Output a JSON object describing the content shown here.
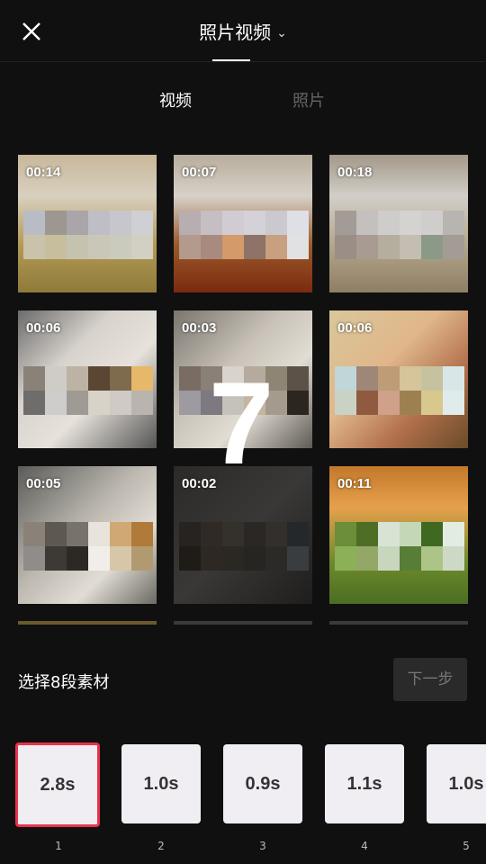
{
  "header": {
    "title": "照片视频",
    "chevron_icon": "chevron-down-icon",
    "close_icon": "close-icon"
  },
  "tabs": [
    {
      "label": "视频",
      "active": true
    },
    {
      "label": "照片",
      "active": false
    }
  ],
  "grid": {
    "tiles": [
      {
        "duration": "00:14"
      },
      {
        "duration": "00:07"
      },
      {
        "duration": "00:18"
      },
      {
        "duration": "00:06"
      },
      {
        "duration": "00:03"
      },
      {
        "duration": "00:06"
      },
      {
        "duration": "00:05"
      },
      {
        "duration": "00:02"
      },
      {
        "duration": "00:11"
      }
    ]
  },
  "overlay_number": "7",
  "footer": {
    "select_label": "选择8段素材",
    "next_button": "下一步"
  },
  "slots": [
    {
      "duration": "2.8s",
      "index": "1",
      "selected": true
    },
    {
      "duration": "1.0s",
      "index": "2"
    },
    {
      "duration": "0.9s",
      "index": "3"
    },
    {
      "duration": "1.1s",
      "index": "4"
    },
    {
      "duration": "1.0s",
      "index": "5"
    }
  ],
  "colors": {
    "background": "#101010",
    "selected_border": "#e8324a",
    "slot_bg": "#f1eef3"
  }
}
